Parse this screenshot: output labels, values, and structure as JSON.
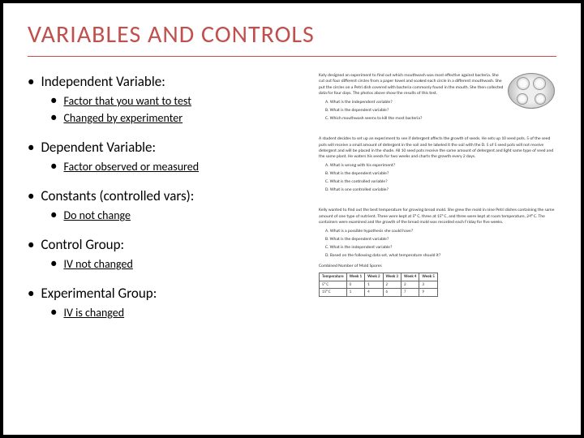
{
  "title": "VARIABLES AND CONTROLS",
  "items": [
    {
      "head": "Independent Variable:",
      "subs": [
        "Factor that you want to test",
        "Changed by experimenter"
      ]
    },
    {
      "head": "Dependent Variable:",
      "subs": [
        "Factor observed or measured"
      ]
    },
    {
      "head": "Constants (controlled vars):",
      "subs": [
        "Do not change"
      ]
    },
    {
      "head": "Control Group:",
      "subs": [
        "IV not changed"
      ]
    },
    {
      "head": "Experimental Group:",
      "subs": [
        "IV is changed"
      ]
    }
  ],
  "ws1": {
    "para": "Katy designed an experiment to find out which mouthwash was most effective against bacteria. She cut out four different circles from a paper towel and soaked each circle in a different mouthwash. She put the circles on a Petri dish covered with bacteria commonly found in the mouth. She then collected data for four days. The photos above show the results of this test.",
    "qA": "A. What is the independent variable?",
    "qB": "B. What is the dependent variable?",
    "qC": "C. Which mouthwash seems to kill the most bacteria?"
  },
  "ws2": {
    "para": "A student decides to set up an experiment to see if detergent affects the growth of seeds. He sets up 10 seed pots. 5 of the seed pots will receive a small amount of detergent in the soil and he labeled it the soil with the D. 5 of 5 seed pots will not receive detergent and will be placed in the shade. All 10 seed pots receive the same amount of detergent and light same type of seed and the same plant. He waters his seeds for two weeks and charts the growth every 2 days.",
    "qA": "A. What is wrong with his experiment?",
    "qB": "B. What is the dependent variable?",
    "qC": "C. What is the controlled variable?",
    "qD": "D. What is one controlled variable?"
  },
  "ws3": {
    "para": "Kelly wanted to find out the best temperature for growing bread mold. She grew the mold in nine Petri dishes containing the same amount of one type of nutrient. Three were kept at 5° C, three at 15° C, and three were kept at room temperature, 24° C. The containers were examined and the growth of the bread mold was recorded each Friday for five weeks.",
    "qA": "A. What is a possible hypothesis she could have?",
    "qB": "B. What is the dependent variable?",
    "qC": "C. What is the independent variable?",
    "qD": "D. Based on the following data set, what temperature should it?"
  },
  "table": {
    "caption": "Combined Number of Mold Spores",
    "headers": [
      "Temperature",
      "Week 1",
      "Week 2",
      "Week 3",
      "Week 4",
      "Week 5"
    ],
    "rows": [
      [
        "5° C",
        "0",
        "1",
        "2",
        "2",
        "3"
      ],
      [
        "15° C",
        "1",
        "4",
        "6",
        "7",
        "9"
      ]
    ]
  }
}
